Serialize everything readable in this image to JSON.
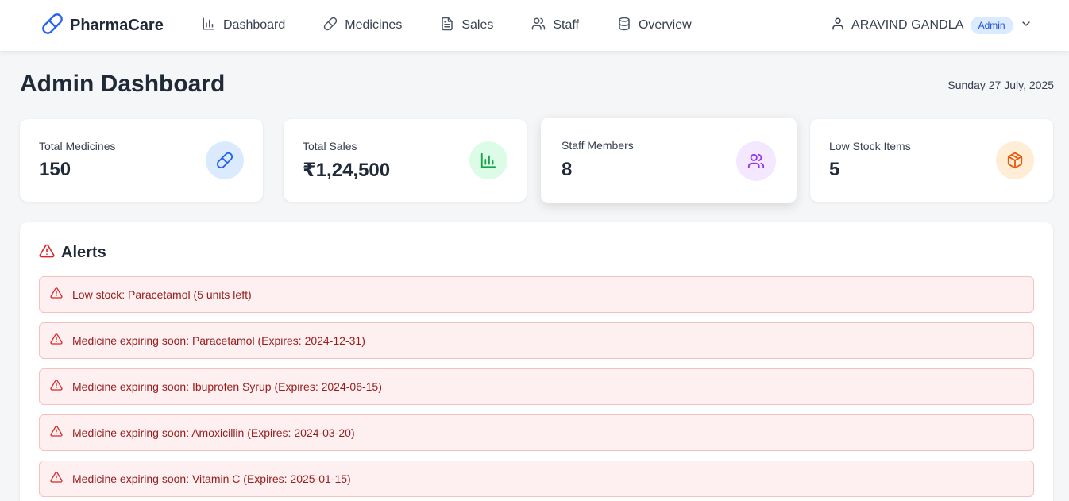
{
  "app": {
    "name": "PharmaCare"
  },
  "nav": {
    "items": [
      {
        "label": "Dashboard",
        "icon": "bar-chart-icon"
      },
      {
        "label": "Medicines",
        "icon": "pill-icon"
      },
      {
        "label": "Sales",
        "icon": "document-icon"
      },
      {
        "label": "Staff",
        "icon": "users-icon"
      },
      {
        "label": "Overview",
        "icon": "database-icon"
      }
    ]
  },
  "user": {
    "name": "ARAVIND GANDLA",
    "role": "Admin"
  },
  "page": {
    "title": "Admin Dashboard",
    "date": "Sunday 27 July, 2025"
  },
  "stats": [
    {
      "label": "Total Medicines",
      "value": "150",
      "icon": "pill-icon",
      "color": "#2563eb",
      "bg": "#dbeafe"
    },
    {
      "label": "Total Sales",
      "value": "₹1,24,500",
      "icon": "bar-chart-icon",
      "color": "#16a34a",
      "bg": "#dcfce7"
    },
    {
      "label": "Staff Members",
      "value": "8",
      "icon": "users-icon",
      "color": "#9333ea",
      "bg": "#f3e8ff"
    },
    {
      "label": "Low Stock Items",
      "value": "5",
      "icon": "package-icon",
      "color": "#ea580c",
      "bg": "#ffedd5"
    }
  ],
  "alerts": {
    "title": "Alerts",
    "items": [
      "Low stock: Paracetamol (5 units left)",
      "Medicine expiring soon: Paracetamol (Expires: 2024-12-31)",
      "Medicine expiring soon: Ibuprofen Syrup (Expires: 2024-06-15)",
      "Medicine expiring soon: Amoxicillin (Expires: 2024-03-20)",
      "Medicine expiring soon: Vitamin C (Expires: 2025-01-15)"
    ]
  },
  "colors": {
    "brand": "#2563eb",
    "alert_text": "#991b1b",
    "alert_bg": "#fef0f0",
    "alert_icon": "#dc2626"
  }
}
